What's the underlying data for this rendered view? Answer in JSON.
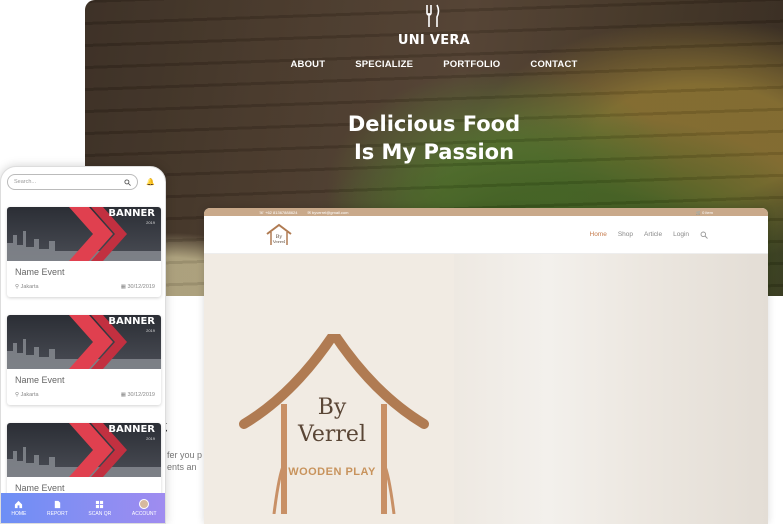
{
  "restaurant": {
    "brand": "UNI VERA",
    "nav": [
      "ABOUT",
      "SPECIALIZE",
      "PORTFOLIO",
      "CONTACT"
    ],
    "hero_line1": "Delicious Food",
    "hero_line2": "Is My Passion",
    "peek_text_1": "fer you p",
    "peek_text_2": "ents an"
  },
  "wooden_play": {
    "top_bar": {
      "phone": "+62 81367888624",
      "email": "byverrel@gmail.com",
      "cart": "0 item"
    },
    "menu": [
      "Home",
      "Shop",
      "Article",
      "Login"
    ],
    "logo_line1": "By",
    "logo_line2": "Verrel",
    "logo_sub": "WOODEN PLAY",
    "colors": {
      "accent": "#c67c4e",
      "top_bar": "#c9a98a"
    }
  },
  "mobile_app": {
    "search_placeholder": "Search...",
    "events": [
      {
        "banner": "BANNER",
        "banner_year": "2019",
        "name": "Name Event",
        "location": "Jakarta",
        "date": "30/12/2019"
      },
      {
        "banner": "BANNER",
        "banner_year": "2019",
        "name": "Name Event",
        "location": "Jakarta",
        "date": "30/12/2019"
      },
      {
        "banner": "BANNER",
        "banner_year": "2019",
        "name": "Name Event"
      }
    ],
    "bottom_nav": [
      {
        "label": "HOME",
        "icon": "home-icon"
      },
      {
        "label": "REPORT",
        "icon": "document-icon"
      },
      {
        "label": "SCAN QR",
        "icon": "grid-icon"
      },
      {
        "label": "ACCOUNT",
        "icon": "avatar-icon"
      }
    ],
    "colors": {
      "nav_gradient_start": "#6d8ff5",
      "nav_gradient_end": "#a08cf0",
      "banner_red": "#e0404f"
    }
  }
}
